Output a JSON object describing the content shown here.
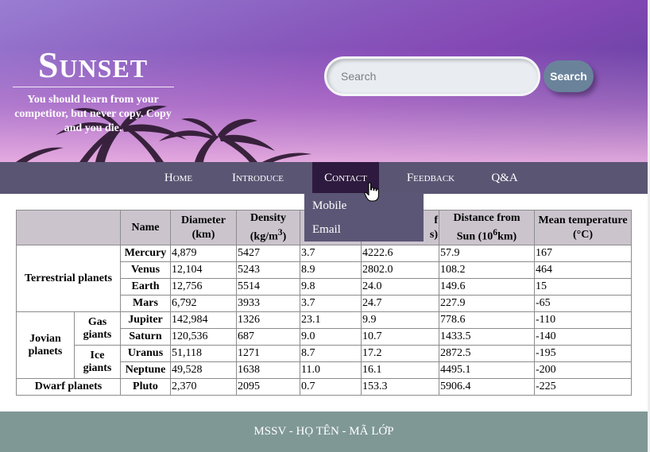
{
  "header": {
    "logo": "Sunset",
    "tagline": "You should learn from your competitor, but never copy. Copy and you die."
  },
  "search": {
    "placeholder": "Search",
    "button_label": "Search"
  },
  "nav": {
    "items": [
      "Home",
      "Introduce",
      "Contact",
      "Feedback",
      "Q&A"
    ],
    "active": "Contact",
    "dropdown": [
      "Mobile",
      "Email"
    ]
  },
  "table": {
    "headers": {
      "name": "Name",
      "diameter": "Diameter (km)",
      "density": "Density",
      "density_unit": "(kg/m",
      "density_sup": "3",
      "density_close": ")",
      "gravity_visible": "",
      "rotation_visible_top": "f",
      "rotation_visible_bottom": "s)",
      "distance": "Distance from",
      "distance_unit": "Sun (10",
      "distance_sup": "6",
      "distance_close": "km)",
      "temperature": "Mean temperature (°C)"
    },
    "groups": {
      "terrestrial": "Terrestrial planets",
      "jovian": "Jovian planets",
      "gas": "Gas giants",
      "ice": "Ice giants",
      "dwarf": "Dwarf planets"
    },
    "rows": [
      {
        "name": "Mercury",
        "diameter": "4,879",
        "density": "5427",
        "gravity": "3.7",
        "rotation": "4222.6",
        "distance": "57.9",
        "temperature": "167"
      },
      {
        "name": "Venus",
        "diameter": "12,104",
        "density": "5243",
        "gravity": "8.9",
        "rotation": "2802.0",
        "distance": "108.2",
        "temperature": "464"
      },
      {
        "name": "Earth",
        "diameter": "12,756",
        "density": "5514",
        "gravity": "9.8",
        "rotation": "24.0",
        "distance": "149.6",
        "temperature": "15"
      },
      {
        "name": "Mars",
        "diameter": "6,792",
        "density": "3933",
        "gravity": "3.7",
        "rotation": "24.7",
        "distance": "227.9",
        "temperature": "-65"
      },
      {
        "name": "Jupiter",
        "diameter": "142,984",
        "density": "1326",
        "gravity": "23.1",
        "rotation": "9.9",
        "distance": "778.6",
        "temperature": "-110"
      },
      {
        "name": "Saturn",
        "diameter": "120,536",
        "density": "687",
        "gravity": "9.0",
        "rotation": "10.7",
        "distance": "1433.5",
        "temperature": "-140"
      },
      {
        "name": "Uranus",
        "diameter": "51,118",
        "density": "1271",
        "gravity": "8.7",
        "rotation": "17.2",
        "distance": "2872.5",
        "temperature": "-195"
      },
      {
        "name": "Neptune",
        "diameter": "49,528",
        "density": "1638",
        "gravity": "11.0",
        "rotation": "16.1",
        "distance": "4495.1",
        "temperature": "-200"
      },
      {
        "name": "Pluto",
        "diameter": "2,370",
        "density": "2095",
        "gravity": "0.7",
        "rotation": "153.3",
        "distance": "5906.4",
        "temperature": "-225"
      }
    ]
  },
  "footer": {
    "text": "MSSV - HỌ TÊN - MÃ LỚP"
  },
  "colors": {
    "navbar": "#5a5573",
    "nav_active": "#2e1a3e",
    "table_header": "#cbc4cd",
    "footer": "#7f9896",
    "search_button": "#6a839b"
  }
}
